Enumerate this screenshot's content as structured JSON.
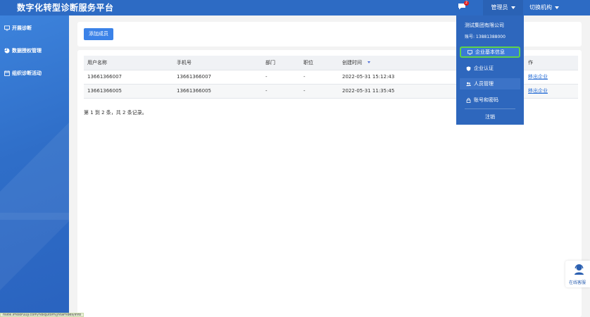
{
  "header": {
    "title": "数字化转型诊断服务平台",
    "message_badge": "2",
    "admin_label": "管理员",
    "switch_org_label": "切换机构"
  },
  "sidebar": {
    "items": [
      {
        "label": "开展诊断",
        "icon": "monitor-icon"
      },
      {
        "label": "数据授权管理",
        "icon": "pie-chart-icon"
      },
      {
        "label": "组织诊断活动",
        "icon": "calendar-icon"
      }
    ]
  },
  "toolbar": {
    "add_member_label": "添加成员"
  },
  "table": {
    "columns": [
      "用户名称",
      "手机号",
      "部门",
      "职位",
      "创建时间",
      "作"
    ],
    "rows": [
      {
        "name": "13661366007",
        "phone": "13661366007",
        "dept": "-",
        "position": "-",
        "created": "2022-05-31 15:12:43",
        "action": "移出企业"
      },
      {
        "name": "13661366005",
        "phone": "13661366005",
        "dept": "-",
        "position": "-",
        "created": "2022-05-31 11:35:45",
        "action": "移出企业"
      }
    ]
  },
  "pagination": {
    "summary": "第 1 到 2 条，共 2 条记录。"
  },
  "dropdown": {
    "company": "测试集团有限公司",
    "account": "账号: 13881388000",
    "items": [
      {
        "label": "企业基本信息",
        "icon": "monitor-icon",
        "state": "highlighted"
      },
      {
        "label": "企业认证",
        "icon": "shield-icon",
        "state": "normal"
      },
      {
        "label": "人员管理",
        "icon": "users-icon",
        "state": "active"
      },
      {
        "label": "账号和密码",
        "icon": "lock-icon",
        "state": "normal"
      }
    ],
    "logout_label": "注销"
  },
  "customer_service": {
    "label": "在线客服"
  },
  "status_bar": {
    "url": "hsite.imooruuy.com/ndiqutom/jntarndes/info"
  },
  "colors": {
    "header_bg": "#2d6bc4",
    "sidebar_bg": "#3577d2",
    "primary_button": "#3b82e8",
    "dropdown_bg": "#2e67bd",
    "highlight_border": "#5ed24a",
    "link": "#2a6fd6"
  }
}
